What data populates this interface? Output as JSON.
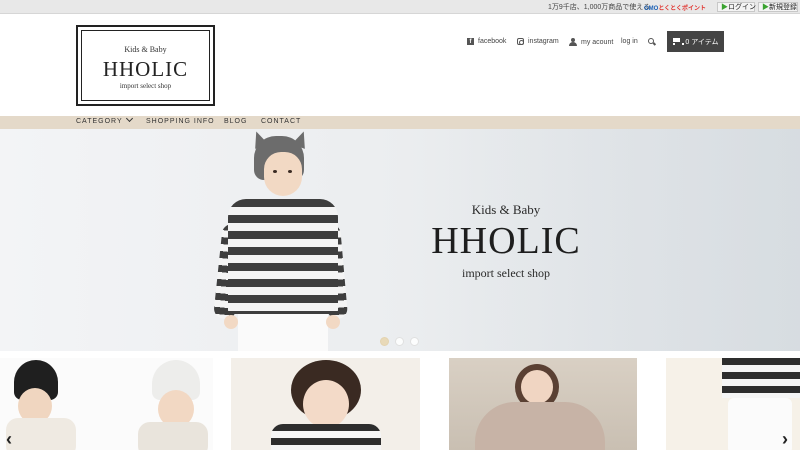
{
  "topbar": {
    "notice": "1万9千店、1,000万商品で使える",
    "gmo_brand": "GMO",
    "gmo_points": "とくとくポイント",
    "login_label": "ログイン",
    "register_label": "新規登録"
  },
  "logo": {
    "subtitle": "Kids & Baby",
    "title": "HHOLIC",
    "tagline": "import select shop"
  },
  "header_nav": {
    "facebook": "facebook",
    "instagram": "instagram",
    "account": "my acount",
    "login": "log in",
    "cart_label": "0 アイテム"
  },
  "main_nav": {
    "items": [
      "CATEGORY",
      "SHOPPING INFO",
      "BLOG",
      "CONTACT"
    ]
  },
  "hero": {
    "subtitle": "Kids & Baby",
    "title": "HHOLIC",
    "tagline": "import select shop",
    "slides_count": 3,
    "active_slide": 1
  },
  "colors": {
    "nav_bg": "#e4d9c9",
    "cart_bg": "#444444",
    "accent_green": "#3aa330"
  },
  "icons": [
    "facebook-icon",
    "instagram-icon",
    "user-icon",
    "search-icon",
    "cart-icon",
    "chevron-down-icon",
    "arrow-left-icon",
    "arrow-right-icon"
  ]
}
